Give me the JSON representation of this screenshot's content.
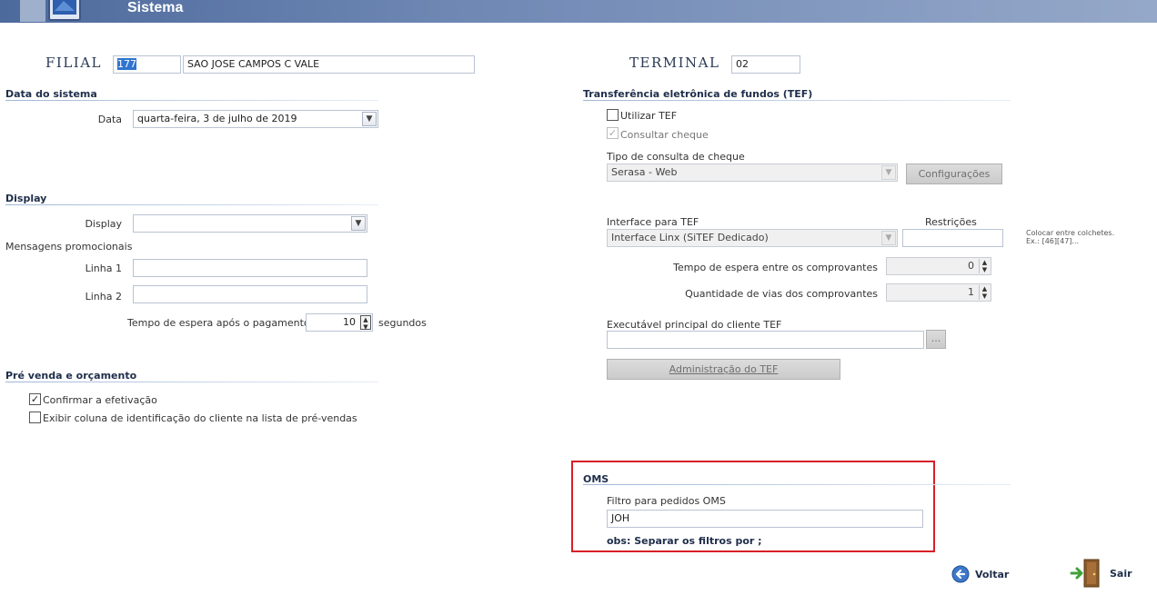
{
  "window": {
    "title": "Sistema"
  },
  "filial": {
    "label": "FILIAL",
    "code": "177",
    "name": "SAO JOSE CAMPOS C VALE"
  },
  "terminal": {
    "label": "TERMINAL",
    "value": "02"
  },
  "data_sistema": {
    "title": "Data do sistema",
    "data_label": "Data",
    "data_value": "quarta-feira, 3 de julho de 2019"
  },
  "display": {
    "title": "Display",
    "display_label": "Display",
    "display_value": "",
    "mensagens_label": "Mensagens promocionais",
    "linha1_label": "Linha 1",
    "linha1_value": "",
    "linha2_label": "Linha 2",
    "linha2_value": "",
    "tempo_label": "Tempo de espera após o pagamento",
    "tempo_value": "10",
    "tempo_unit": "segundos"
  },
  "pre_venda": {
    "title": "Pré venda e orçamento",
    "confirmar_label": "Confirmar a efetivação",
    "confirmar_checked": true,
    "exibir_label": "Exibir coluna de identificação do cliente na lista de pré-vendas",
    "exibir_checked": false
  },
  "tef": {
    "title": "Transferência eletrônica de fundos (TEF)",
    "utilizar_label": "Utilizar TEF",
    "utilizar_checked": false,
    "consultar_label": "Consultar cheque",
    "consultar_checked": true,
    "tipo_consulta_label": "Tipo de consulta de cheque",
    "tipo_consulta_value": "Serasa - Web",
    "configuracoes_button": "Configurações",
    "interface_label": "Interface para TEF",
    "interface_value": "Interface Linx (SiTEF Dedicado)",
    "restricoes_label": "Restrições",
    "restricoes_value": "",
    "restricoes_hint_1": "Colocar entre colchetes.",
    "restricoes_hint_2": "Ex.: [46][47]...",
    "tempo_comprovantes_label": "Tempo de espera entre os comprovantes",
    "tempo_comprovantes_value": "0",
    "qtd_vias_label": "Quantidade de vias dos comprovantes",
    "qtd_vias_value": "1",
    "executavel_label": "Executável principal do cliente TEF",
    "executavel_value": "",
    "browse_button": "...",
    "administracao_button": "Administração do TEF"
  },
  "oms": {
    "title": "OMS",
    "filtro_label": "Filtro para pedidos OMS",
    "filtro_value": "JOH",
    "obs": "obs: Separar os filtros por ;"
  },
  "footer": {
    "voltar": "Voltar",
    "sair": "Sair"
  },
  "colors": {
    "highlight_border": "#d62027",
    "title_bar": "#6f88b4",
    "selection": "#3074d0"
  }
}
